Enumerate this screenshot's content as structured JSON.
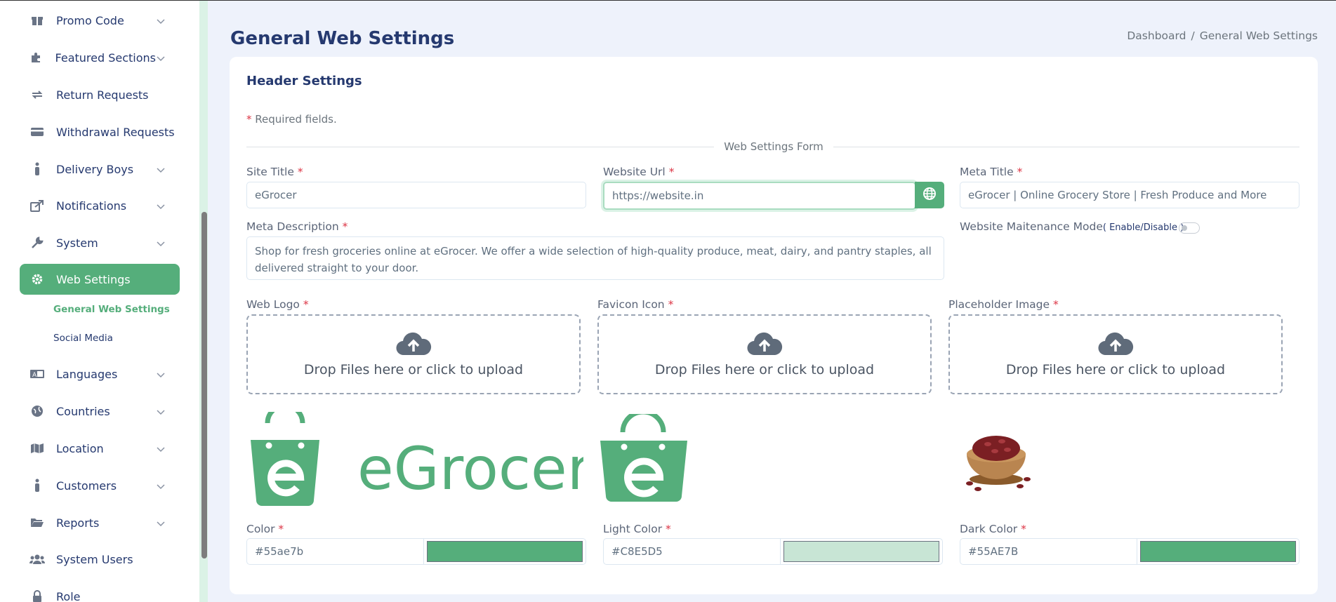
{
  "sidebar": {
    "items": [
      {
        "label": "Promo Code",
        "icon": "gift-icon",
        "has_children": true
      },
      {
        "label": "Featured Sections",
        "icon": "puzzle-icon",
        "has_children": true
      },
      {
        "label": "Return Requests",
        "icon": "return-arrows-icon",
        "has_children": false
      },
      {
        "label": "Withdrawal Requests",
        "icon": "credit-card-icon",
        "has_children": false
      },
      {
        "label": "Delivery Boys",
        "icon": "person-icon",
        "has_children": true
      },
      {
        "label": "Notifications",
        "icon": "share-icon",
        "has_children": true
      },
      {
        "label": "System",
        "icon": "wrench-icon",
        "has_children": true
      },
      {
        "label": "Web Settings",
        "icon": "gear-icon",
        "has_children": true,
        "active": true
      },
      {
        "label": "Languages",
        "icon": "language-icon",
        "has_children": true
      },
      {
        "label": "Countries",
        "icon": "globe-icon",
        "has_children": true
      },
      {
        "label": "Location",
        "icon": "map-icon",
        "has_children": true
      },
      {
        "label": "Customers",
        "icon": "person-icon",
        "has_children": true
      },
      {
        "label": "Reports",
        "icon": "folder-icon",
        "has_children": true
      },
      {
        "label": "System Users",
        "icon": "users-icon",
        "has_children": false
      },
      {
        "label": "Role",
        "icon": "lock-icon",
        "has_children": false
      }
    ],
    "subitems": [
      {
        "label": "General Web Settings",
        "active": true
      },
      {
        "label": "Social Media",
        "active": false
      }
    ]
  },
  "header": {
    "title": "General Web Settings",
    "breadcrumb": [
      "Dashboard",
      "/",
      "General Web Settings"
    ]
  },
  "card": {
    "title": "Header Settings",
    "required_star": "*",
    "required_note": "Required fields.",
    "section_label": "Web Settings Form"
  },
  "form": {
    "site_title_label": "Site Title",
    "site_title_value": "eGrocer",
    "website_url_label": "Website Url",
    "website_url_value": "https://website.in",
    "meta_title_label": "Meta Title",
    "meta_title_value": "eGrocer | Online Grocery Store | Fresh Produce and More",
    "meta_description_label": "Meta Description",
    "meta_description_value": "Shop for fresh groceries online at eGrocer. We offer a wide selection of high-quality produce, meat, dairy, and pantry staples, all delivered straight to your door.",
    "maintenance_label": "Website Maitenance Mode",
    "maintenance_hint": "( Enable/Disable )",
    "maintenance_enabled": false,
    "star": "*"
  },
  "uploads": [
    {
      "label": "Web Logo",
      "text": "Drop Files here or click to upload"
    },
    {
      "label": "Favicon Icon",
      "text": "Drop Files here or click to upload"
    },
    {
      "label": "Placeholder Image",
      "text": "Drop Files here or click to upload"
    }
  ],
  "logo_text": "eGrocer",
  "colors": [
    {
      "label": "Color",
      "value": "#55ae7b",
      "swatch": "#55ae7b"
    },
    {
      "label": "Light Color",
      "value": "#C8E5D5",
      "swatch": "#C8E5D5"
    },
    {
      "label": "Dark Color",
      "value": "#55AE7B",
      "swatch": "#55AE7B"
    }
  ],
  "theme": {
    "accent": "#55ae7b",
    "navy": "#25396f"
  }
}
